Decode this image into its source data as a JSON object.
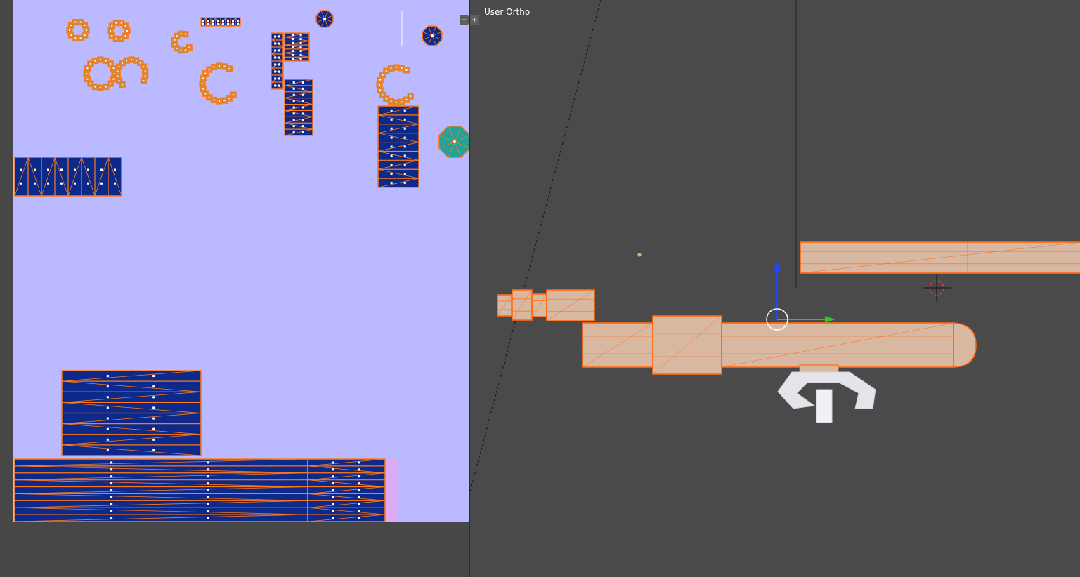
{
  "viewport": {
    "label": "User Ortho"
  },
  "uv_editor": {
    "background_color": "#bbb9ff",
    "island_fill": "#0d2a8a",
    "island_edge": "#ff7a1a"
  },
  "area_corner_icons": [
    "split-handle-icon",
    "add-area-icon"
  ]
}
